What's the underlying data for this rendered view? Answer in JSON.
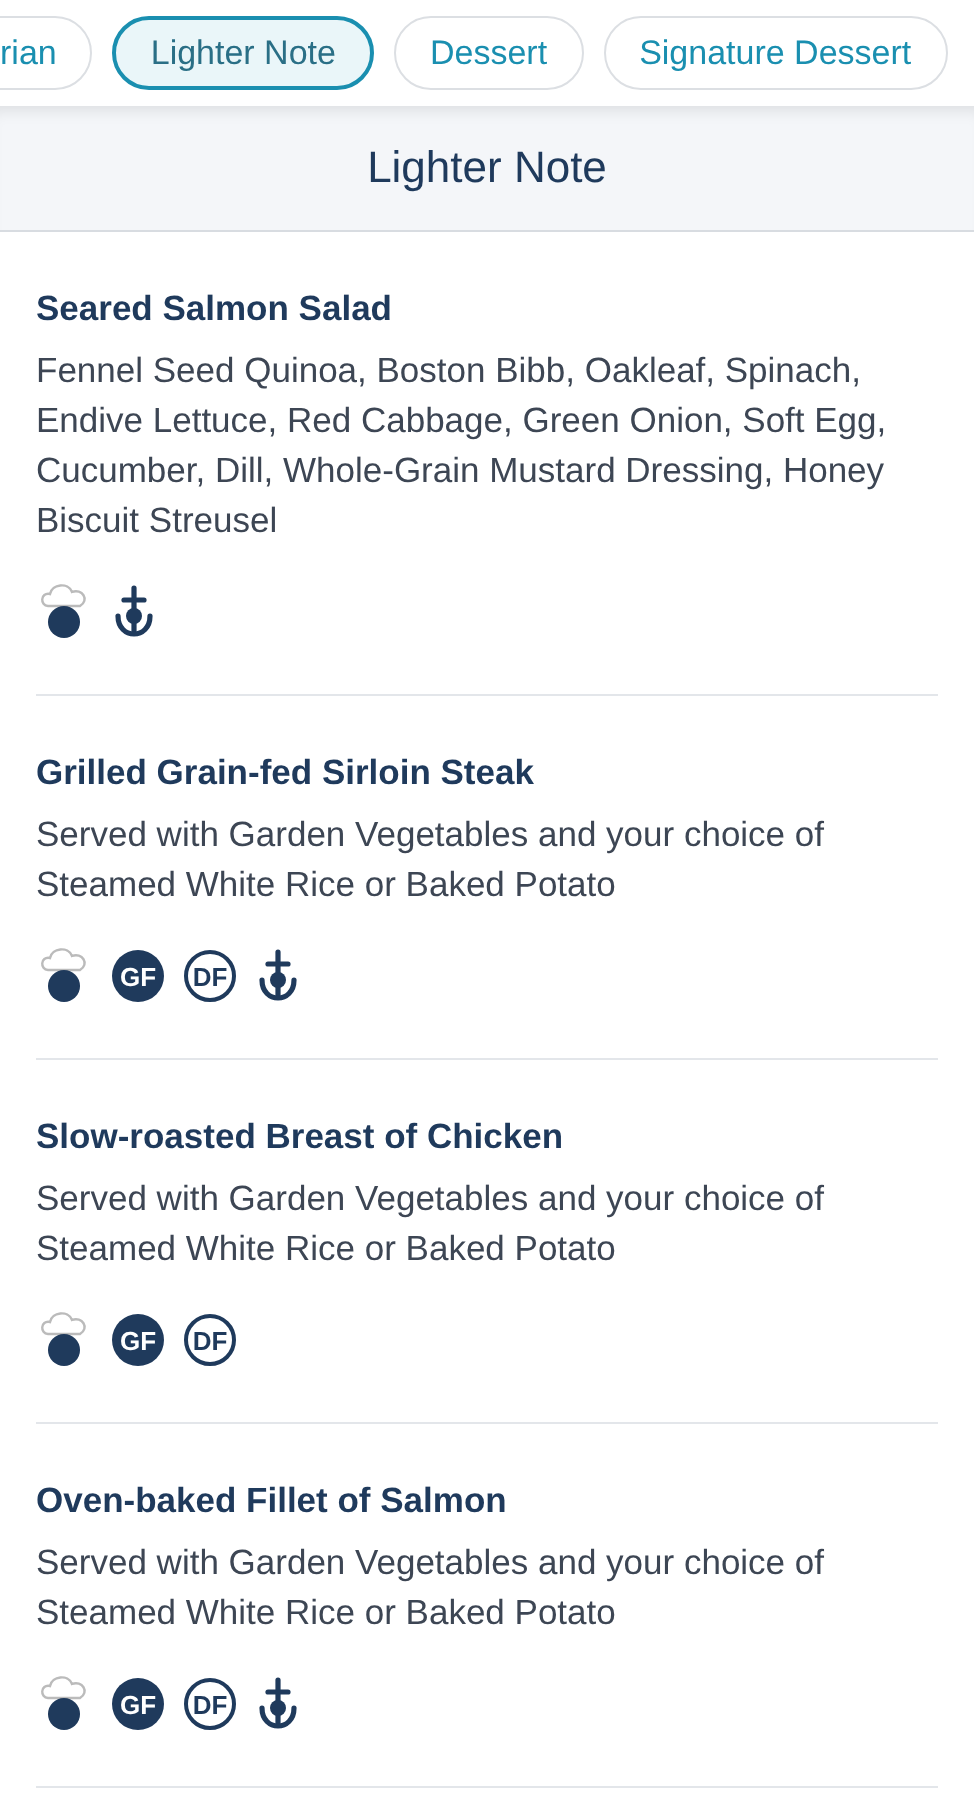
{
  "tabs": [
    {
      "label": "rian",
      "selected": false
    },
    {
      "label": "Lighter Note",
      "selected": true
    },
    {
      "label": "Dessert",
      "selected": false
    },
    {
      "label": "Signature Dessert",
      "selected": false
    }
  ],
  "section": {
    "title": "Lighter Note"
  },
  "items": [
    {
      "name": "Seared Salmon Salad",
      "description": "Fennel Seed Quinoa, Boston Bibb, Oakleaf, Spinach, Endive Lettuce, Red Cabbage, Green Onion, Soft Egg, Cucumber, Dill, Whole-Grain Mustard Dressing, Honey Biscuit Streusel",
      "icons": [
        {
          "kind": "chef"
        },
        {
          "kind": "anchor"
        }
      ]
    },
    {
      "name": "Grilled Grain-fed Sirloin Steak",
      "description": "Served with Garden Vegetables and your choice of Steamed White Rice or Baked Potato",
      "icons": [
        {
          "kind": "chef"
        },
        {
          "kind": "gf",
          "label": "GF"
        },
        {
          "kind": "df",
          "label": "DF"
        },
        {
          "kind": "anchor"
        }
      ]
    },
    {
      "name": "Slow-roasted Breast of Chicken",
      "description": "Served with Garden Vegetables and your choice of Steamed White Rice or Baked Potato",
      "icons": [
        {
          "kind": "chef"
        },
        {
          "kind": "gf",
          "label": "GF"
        },
        {
          "kind": "df",
          "label": "DF"
        }
      ]
    },
    {
      "name": "Oven-baked Fillet of Salmon",
      "description": "Served with Garden Vegetables and your choice of Steamed White Rice or Baked Potato",
      "icons": [
        {
          "kind": "chef"
        },
        {
          "kind": "gf",
          "label": "GF"
        },
        {
          "kind": "df",
          "label": "DF"
        },
        {
          "kind": "anchor"
        }
      ]
    }
  ]
}
